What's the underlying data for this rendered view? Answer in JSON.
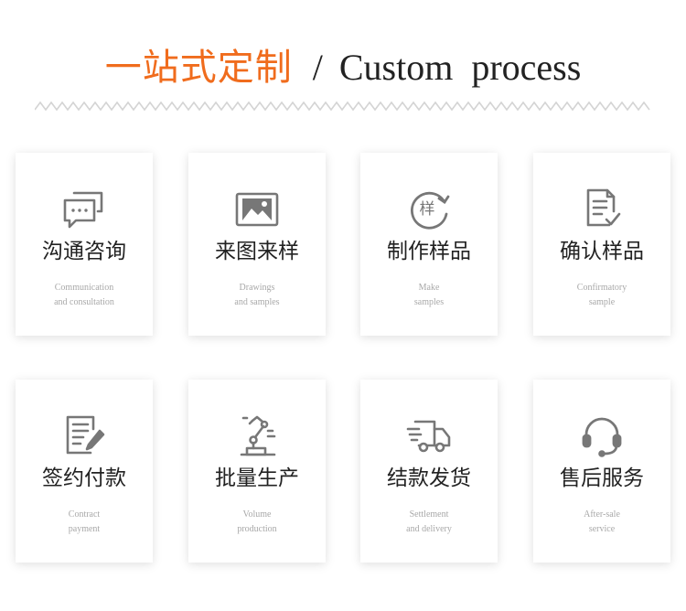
{
  "header": {
    "title_cn": "一站式定制",
    "separator": "/",
    "title_en": "Custom process"
  },
  "colors": {
    "accent": "#f06c1d",
    "icon": "#777777",
    "card_text": "#222222",
    "card_subtext": "#a8a8a8",
    "zigzag": "#d4d4d4"
  },
  "steps": [
    {
      "icon": "chat-bubbles-icon",
      "cn": "沟通咨询",
      "en1": "Communication",
      "en2": "and consultation"
    },
    {
      "icon": "picture-icon",
      "cn": "来图来样",
      "en1": "Drawings",
      "en2": "and samples"
    },
    {
      "icon": "sample-cycle-icon",
      "cn": "制作样品",
      "en1": "Make",
      "en2": "samples",
      "glyph": "样"
    },
    {
      "icon": "document-check-icon",
      "cn": "确认样品",
      "en1": "Confirmatory",
      "en2": "sample"
    },
    {
      "icon": "contract-sign-icon",
      "cn": "签约付款",
      "en1": "Contract",
      "en2": "payment"
    },
    {
      "icon": "robot-arm-icon",
      "cn": "批量生产",
      "en1": "Volume",
      "en2": "production"
    },
    {
      "icon": "delivery-truck-icon",
      "cn": "结款发货",
      "en1": "Settlement",
      "en2": "and delivery"
    },
    {
      "icon": "headset-icon",
      "cn": "售后服务",
      "en1": "After-sale",
      "en2": "service"
    }
  ]
}
